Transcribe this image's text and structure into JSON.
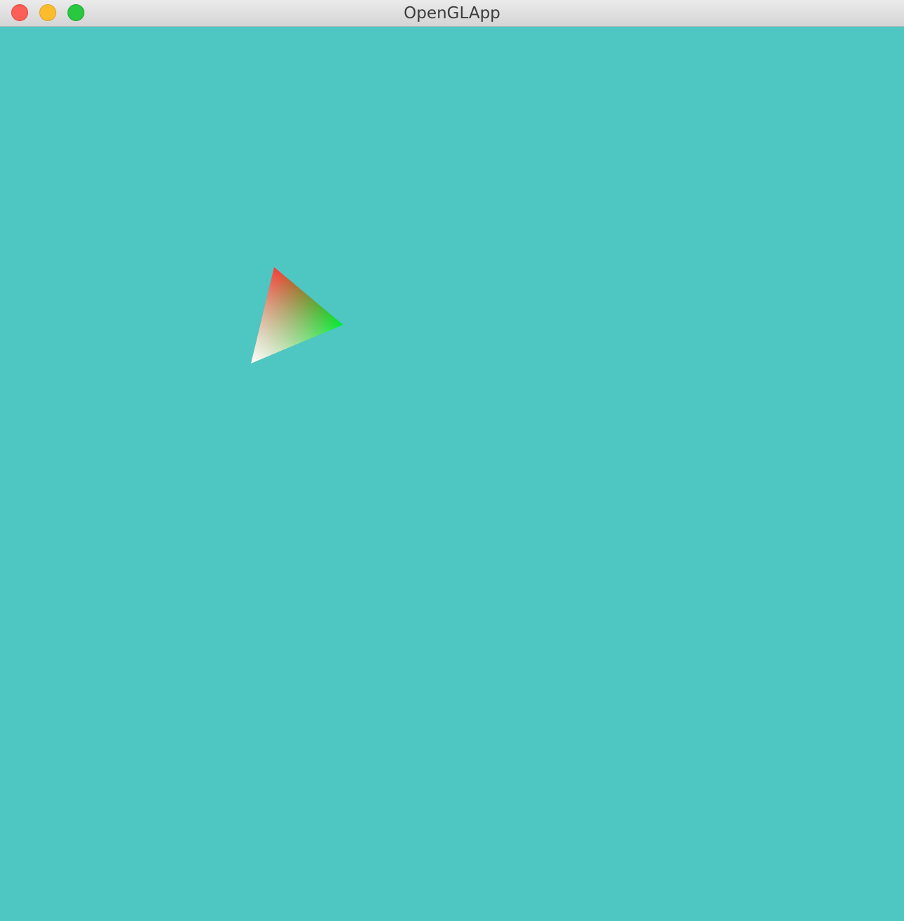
{
  "window": {
    "title": "OpenGLApp",
    "buttons": [
      "close",
      "minimize",
      "zoom"
    ]
  },
  "scene": {
    "clear_color": "#4ec6c2",
    "triangle": {
      "vertex_colors": [
        "#ff3b3b",
        "#00ee33",
        "#ffffff"
      ]
    }
  }
}
